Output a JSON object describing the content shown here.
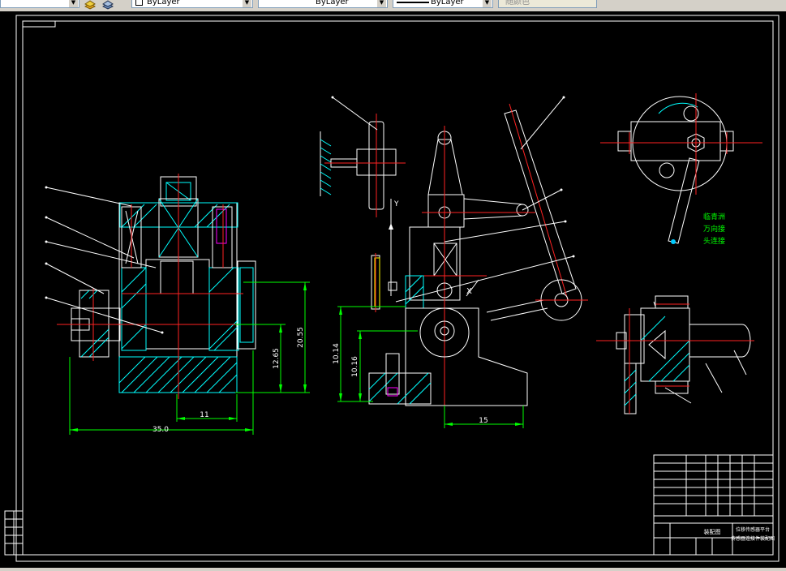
{
  "toolbar": {
    "layer_combo": {
      "value": "ByLayer"
    },
    "color_combo": {
      "value": "ByLayer"
    },
    "linetype_combo": {
      "value": "ByLayer"
    },
    "plotstyle_combo": {
      "value": "随颜色"
    }
  },
  "drawing": {
    "dims": {
      "d1": "11",
      "d2": "35.0",
      "d3": "12.65",
      "d4": "20.55",
      "d5": "10.14",
      "d6": "10.16",
      "d7": "15"
    },
    "notes": {
      "n1": "临青洲",
      "n2": "万向接",
      "n3": "头连接"
    },
    "title_block": {
      "name_line1": "位移传感器平台",
      "name_line2": "传感器连接件装配图",
      "left_label": "装配图"
    }
  },
  "colors": {
    "background": "#000000",
    "outline": "#ffffff",
    "section": "#00ffff",
    "centerline": "#ff2020",
    "dimension": "#00ff00",
    "text": "#ffffff",
    "accent": "#ff00ff",
    "highlight": "#ffff00"
  }
}
